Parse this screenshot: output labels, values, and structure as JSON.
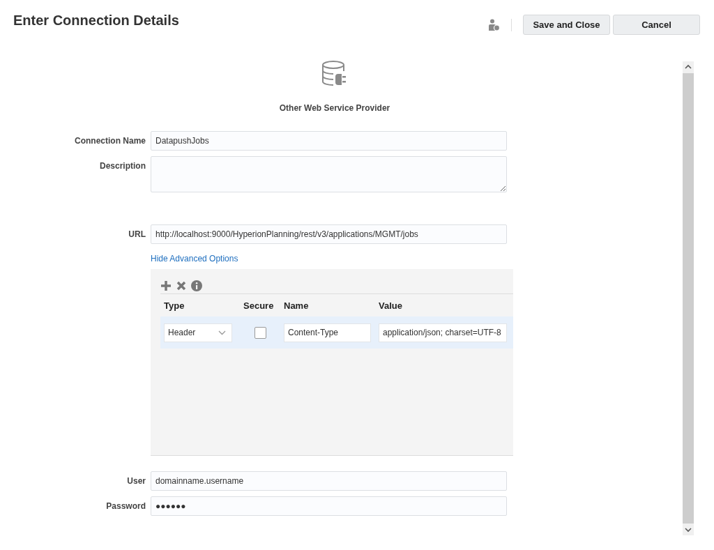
{
  "header": {
    "title": "Enter Connection Details",
    "buttons": [
      {
        "label": "Save and Close"
      },
      {
        "label": "Cancel"
      }
    ]
  },
  "provider": {
    "name": "Other Web Service Provider"
  },
  "fields": [
    {
      "label": "Connection Name",
      "value": "DatapushJobs",
      "kind": "text"
    },
    {
      "label": "Description",
      "kind": "textarea"
    },
    {
      "label": "URL",
      "value": "http://localhost:9000/HyperionPlanning/rest/v3/applications/MGMT/jobs",
      "kind": "text"
    }
  ],
  "advanced_link": "Hide Advanced Options",
  "table": {
    "columns": [
      "Type",
      "Secure",
      "Name",
      "Value"
    ],
    "rows": [
      {
        "type": "Header",
        "secure": false,
        "name": "Content-Type",
        "value": "application/json; charset=UTF-8",
        "selected": true
      }
    ]
  },
  "credentials": [
    {
      "label": "User",
      "value": "domainname.username"
    },
    {
      "label": "Password",
      "value": "●●●●●●"
    }
  ]
}
